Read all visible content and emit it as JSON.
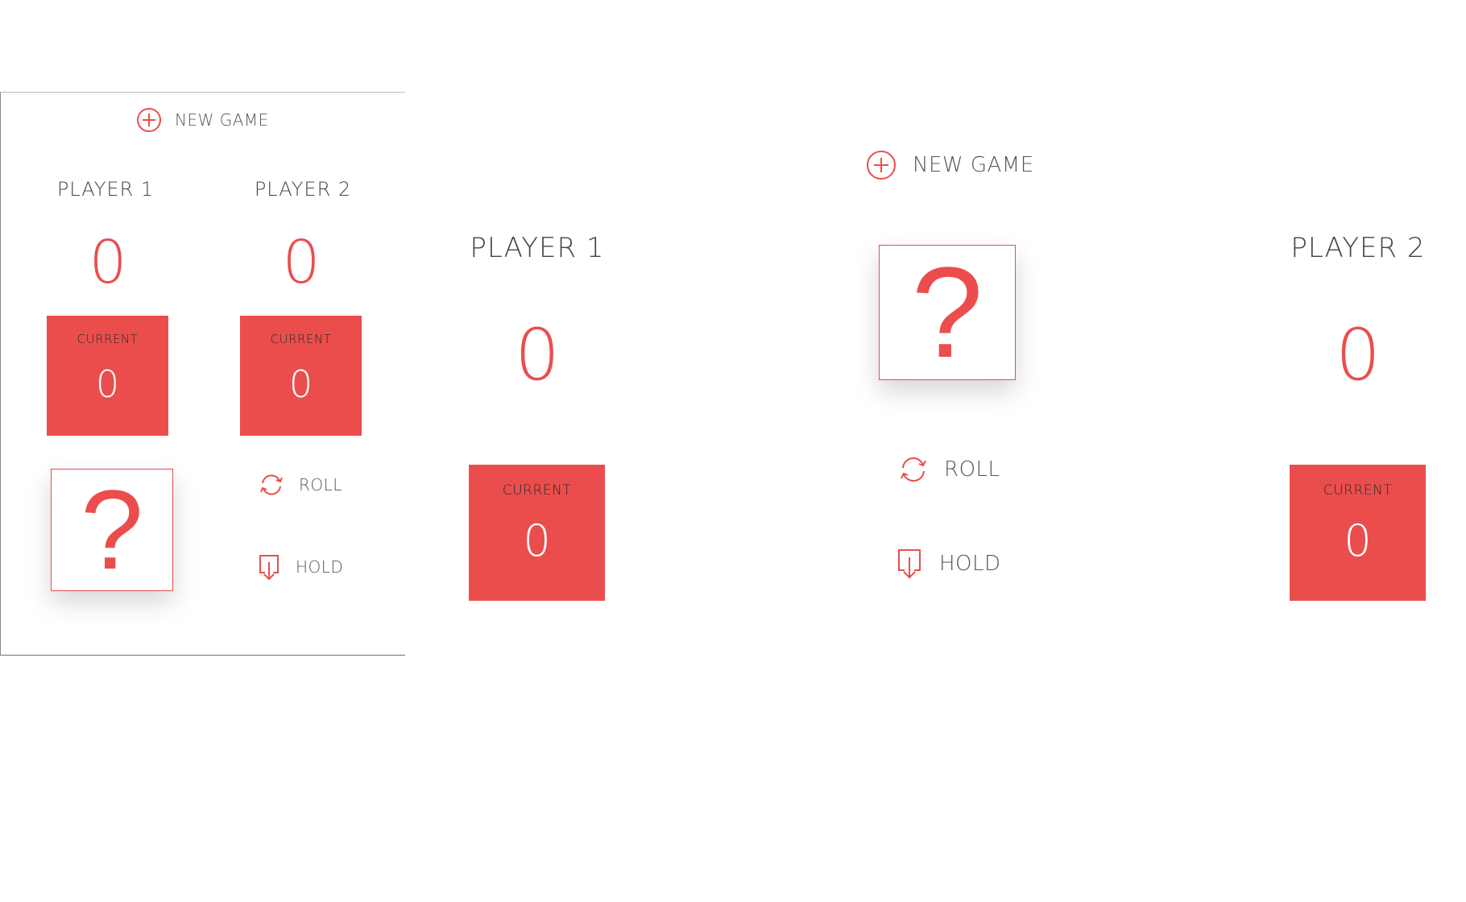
{
  "colors": {
    "accent": "#eb4d4d",
    "text": "#555555",
    "white": "#ffffff"
  },
  "mobile": {
    "new_game_label": "NEW GAME",
    "new_game_icon": "plus-circle-icon",
    "players": [
      {
        "name": "PLAYER 1",
        "score": "0",
        "current_label": "CURRENT",
        "current_value": "0"
      },
      {
        "name": "PLAYER 2",
        "score": "0",
        "current_label": "CURRENT",
        "current_value": "0"
      }
    ],
    "dice_glyph": "?",
    "roll_label": "ROLL",
    "roll_icon": "refresh-icon",
    "hold_label": "HOLD",
    "hold_icon": "hold-download-icon"
  },
  "desktop": {
    "new_game_label": "NEW GAME",
    "new_game_icon": "plus-circle-icon",
    "players": [
      {
        "name": "PLAYER 1",
        "score": "0",
        "current_label": "CURRENT",
        "current_value": "0"
      },
      {
        "name": "PLAYER 2",
        "score": "0",
        "current_label": "CURRENT",
        "current_value": "0"
      }
    ],
    "dice_glyph": "?",
    "roll_label": "ROLL",
    "roll_icon": "refresh-icon",
    "hold_label": "HOLD",
    "hold_icon": "hold-download-icon"
  }
}
